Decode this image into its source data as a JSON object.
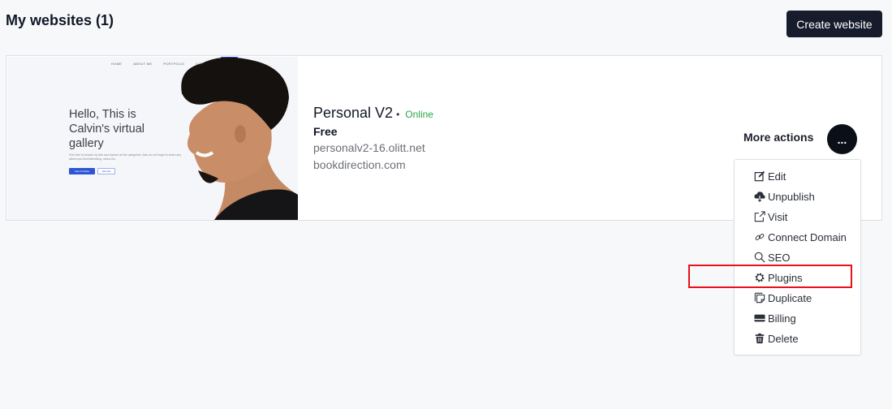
{
  "header": {
    "title": "My websites (1)",
    "create_button": "Create website"
  },
  "site": {
    "thumbnail": {
      "nav": [
        "HOME",
        "ABOUT ME",
        "PORTFOLIO",
        "CONTACT"
      ],
      "cta": "Hire Me",
      "heading": "Hello, This is Calvin's virtual gallery",
      "subtext": "Feel free to browse my site and explore all the categories. Also do not forget to share any album you find interesting, minus fun",
      "primary_button": "View Portfolio",
      "secondary_button": "Hire Me"
    },
    "name": "Personal V2",
    "separator": "•",
    "status": "Online",
    "plan": "Free",
    "subdomain": "personalv2-16.olitt.net",
    "domain": "bookdirection.com",
    "more_actions_label": "More actions",
    "more_button": "...",
    "colors": {
      "status": "#28a745",
      "highlight": "#e8101a",
      "primary_dark": "#171c2c"
    }
  },
  "menu": {
    "items": [
      {
        "label": "Edit",
        "icon": "edit-icon"
      },
      {
        "label": "Unpublish",
        "icon": "cloud-download-icon"
      },
      {
        "label": "Visit",
        "icon": "external-link-icon"
      },
      {
        "label": "Connect Domain",
        "icon": "link-icon"
      },
      {
        "label": "SEO",
        "icon": "search-icon"
      },
      {
        "label": "Plugins",
        "icon": "gear-icon"
      },
      {
        "label": "Duplicate",
        "icon": "duplicate-icon"
      },
      {
        "label": "Billing",
        "icon": "credit-card-icon"
      },
      {
        "label": "Delete",
        "icon": "trash-icon"
      }
    ],
    "highlighted": "Plugins"
  }
}
